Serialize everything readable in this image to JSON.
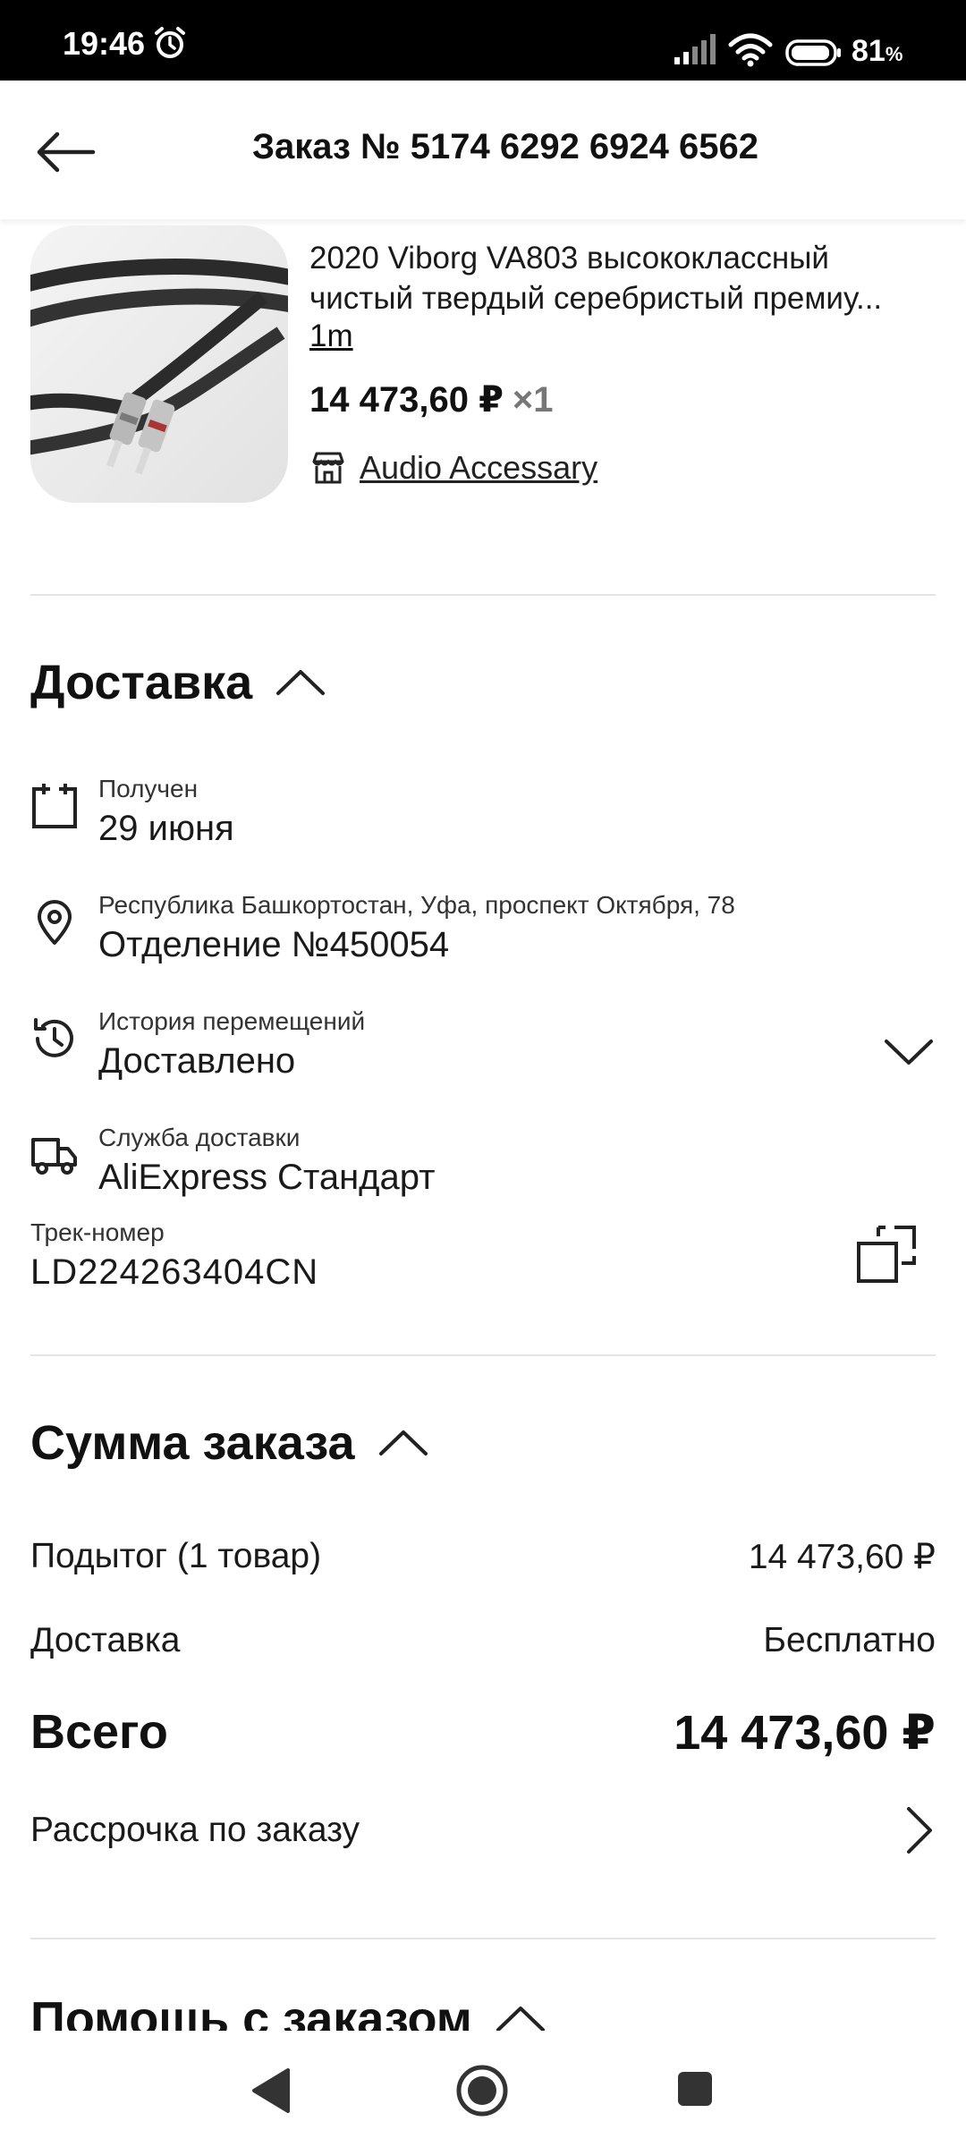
{
  "status_bar": {
    "time": "19:46",
    "battery": "81",
    "battery_unit": "%"
  },
  "header": {
    "title": "Заказ № 5174 6292 6924 6562"
  },
  "product": {
    "title_line1": "2020 Viborg VA803 высококлассный",
    "title_line2": "чистый твердый серебристый премиу...",
    "variant": "1m",
    "price": "14 473,60 ₽",
    "quantity": "×1",
    "store": "Audio Accessary"
  },
  "delivery": {
    "title": "Доставка",
    "received": {
      "label": "Получен",
      "value": "29 июня"
    },
    "address": {
      "label": "Республика Башкортостан, Уфа, проспект Октября, 78",
      "value": "Отделение №450054"
    },
    "history": {
      "label": "История перемещений",
      "value": "Доставлено"
    },
    "service": {
      "label": "Служба доставки",
      "value": "AliExpress Стандарт"
    },
    "tracking": {
      "label": "Трек-номер",
      "value": "LD224263404CN"
    }
  },
  "summary": {
    "title": "Сумма заказа",
    "subtotal_label": "Подытог (1 товар)",
    "subtotal_value": "14 473,60 ₽",
    "shipping_label": "Доставка",
    "shipping_value": "Бесплатно",
    "total_label": "Всего",
    "total_value": "14 473,60 ₽",
    "installment_label": "Рассрочка по заказу"
  },
  "help": {
    "title": "Помощь с заказом"
  },
  "icons": {
    "back": "arrow-left-icon",
    "calendar": "calendar-icon",
    "location": "location-pin-icon",
    "history": "history-clock-icon",
    "truck": "truck-icon",
    "copy": "copy-icon",
    "store": "store-icon"
  }
}
